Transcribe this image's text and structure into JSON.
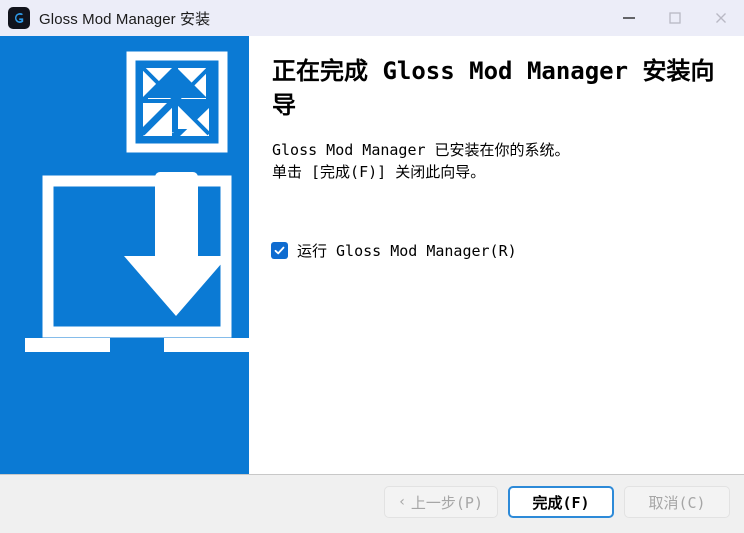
{
  "window": {
    "title": "Gloss Mod Manager 安装",
    "app_icon": "gloss-g-icon",
    "titlebar_bg": "#ecedf8",
    "accent": "#0b7ad4"
  },
  "titlebar_buttons": [
    {
      "name": "minimize-button",
      "label": "—",
      "state": "enabled"
    },
    {
      "name": "maximize-button",
      "label": "□",
      "state": "disabled"
    },
    {
      "name": "close-button",
      "label": "✕",
      "state": "disabled"
    }
  ],
  "sidebar": {
    "background": "#0b7ad4",
    "graphics": [
      {
        "name": "mesh-square-icon",
        "description": "白色方框内三角网格图案"
      },
      {
        "name": "install-download-icon",
        "description": "向下箭头指向笔记本电脑"
      }
    ]
  },
  "content": {
    "heading": "正在完成 Gloss Mod Manager 安装向导",
    "body": "Gloss Mod Manager 已安装在你的系统。\n单击 [完成(F)] 关闭此向导。",
    "run_option": {
      "label": "运行 Gloss Mod Manager(R)",
      "checked": true,
      "check_color": "#0f6cd0"
    }
  },
  "footer": {
    "buttons": [
      {
        "name": "back-button",
        "chevron": "‹",
        "label": "上一步(P)",
        "state": "disabled"
      },
      {
        "name": "finish-button",
        "label": "完成(F)",
        "state": "default"
      },
      {
        "name": "cancel-button",
        "label": "取消(C)",
        "state": "disabled"
      }
    ]
  }
}
